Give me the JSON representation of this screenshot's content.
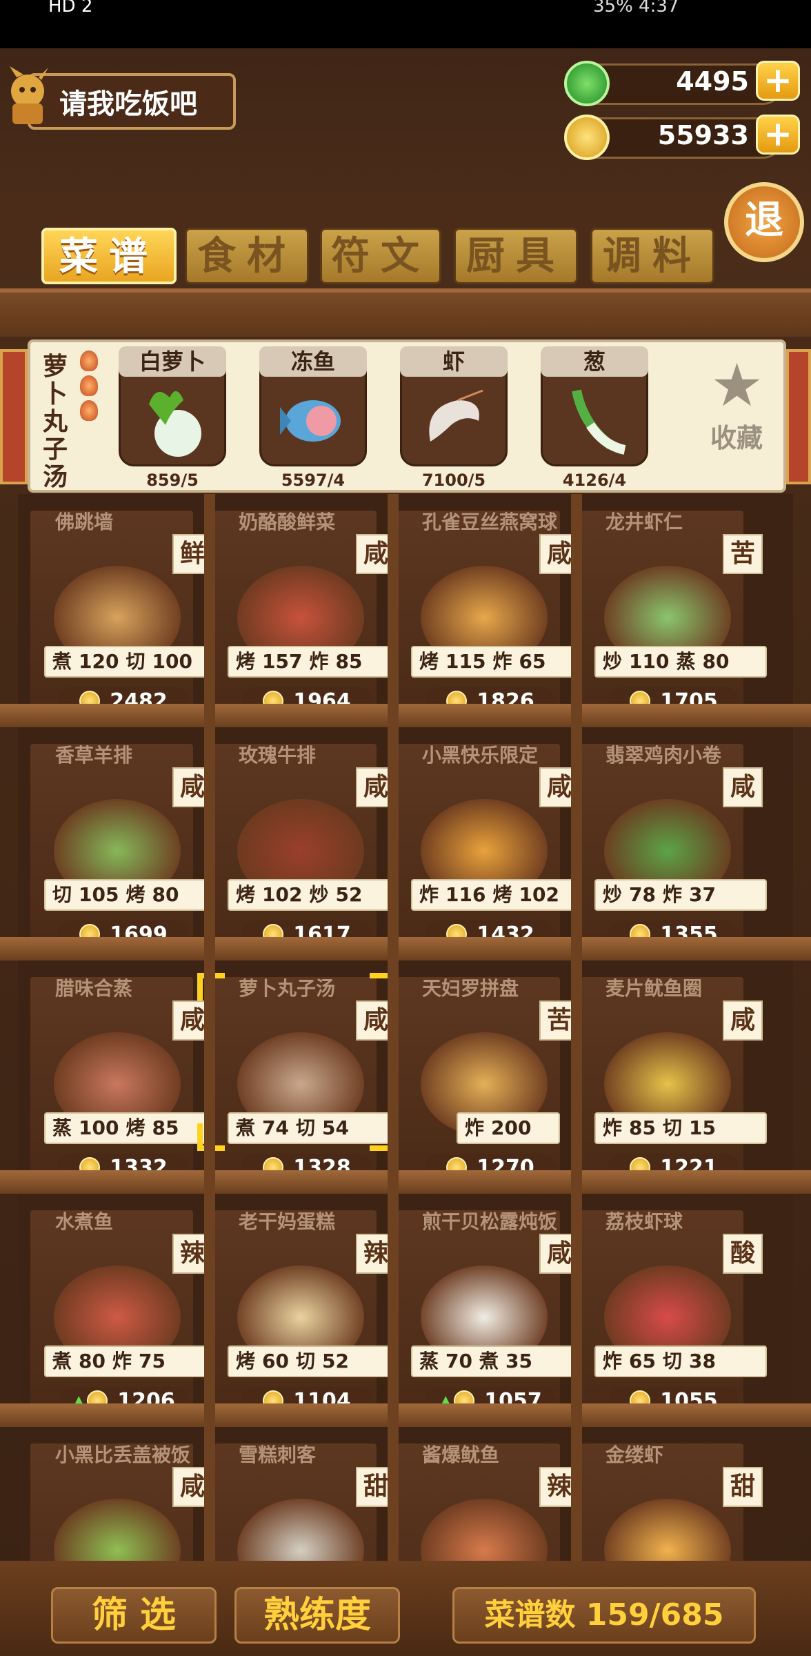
{
  "status_bar": {
    "left": "HD 2",
    "right": "35% 4:37"
  },
  "header": {
    "title": "请我吃饭吧",
    "jade": "4495",
    "coins": "55933",
    "exit_label": "退"
  },
  "tabs": [
    {
      "label": "菜谱",
      "active": true
    },
    {
      "label": "食材",
      "active": false
    },
    {
      "label": "符文",
      "active": false
    },
    {
      "label": "厨具",
      "active": false
    },
    {
      "label": "调料",
      "active": false
    }
  ],
  "selected_recipe": {
    "name": "萝卜丸子汤",
    "ingredients": [
      {
        "name": "白萝卜",
        "count": "859/5"
      },
      {
        "name": "冻鱼",
        "count": "5597/4"
      },
      {
        "name": "虾",
        "count": "7100/5"
      },
      {
        "name": "葱",
        "count": "4126/4"
      }
    ],
    "favorite_label": "收藏"
  },
  "recipes": [
    {
      "title": "佛跳墙",
      "taste": "鲜",
      "stats": [
        [
          "煮",
          "120"
        ],
        [
          "切",
          "100"
        ]
      ],
      "price": "2482",
      "up": false
    },
    {
      "title": "奶酪酸鲜菜",
      "taste": "咸",
      "stats": [
        [
          "烤",
          "157"
        ],
        [
          "炸",
          "85"
        ]
      ],
      "price": "1964",
      "up": false
    },
    {
      "title": "孔雀豆丝燕窝球",
      "taste": "咸",
      "stats": [
        [
          "烤",
          "115"
        ],
        [
          "炸",
          "65"
        ]
      ],
      "price": "1826",
      "up": false
    },
    {
      "title": "龙井虾仁",
      "taste": "苦",
      "stats": [
        [
          "炒",
          "110"
        ],
        [
          "蒸",
          "80"
        ]
      ],
      "price": "1705",
      "up": false
    },
    {
      "title": "香草羊排",
      "taste": "咸",
      "stats": [
        [
          "切",
          "105"
        ],
        [
          "烤",
          "80"
        ]
      ],
      "price": "1699",
      "up": false
    },
    {
      "title": "玫瑰牛排",
      "taste": "咸",
      "stats": [
        [
          "烤",
          "102"
        ],
        [
          "炒",
          "52"
        ]
      ],
      "price": "1617",
      "up": false
    },
    {
      "title": "小黑快乐限定",
      "taste": "咸",
      "stats": [
        [
          "炸",
          "116"
        ],
        [
          "烤",
          "102"
        ]
      ],
      "price": "1432",
      "up": false
    },
    {
      "title": "翡翠鸡肉小卷",
      "taste": "咸",
      "stats": [
        [
          "炒",
          "78"
        ],
        [
          "炸",
          "37"
        ]
      ],
      "price": "1355",
      "up": false
    },
    {
      "title": "腊味合蒸",
      "taste": "咸",
      "stats": [
        [
          "蒸",
          "100"
        ],
        [
          "烤",
          "85"
        ]
      ],
      "price": "1332",
      "up": false
    },
    {
      "title": "萝卜丸子汤",
      "taste": "咸",
      "stats": [
        [
          "煮",
          "74"
        ],
        [
          "切",
          "54"
        ]
      ],
      "price": "1328",
      "up": false,
      "selected": true
    },
    {
      "title": "天妇罗拼盘",
      "taste": "苦",
      "stats": [
        [
          "炸",
          "200"
        ]
      ],
      "price": "1270",
      "up": false
    },
    {
      "title": "麦片鱿鱼圈",
      "taste": "咸",
      "stats": [
        [
          "炸",
          "85"
        ],
        [
          "切",
          "15"
        ]
      ],
      "price": "1221",
      "up": false
    },
    {
      "title": "水煮鱼",
      "taste": "辣",
      "stats": [
        [
          "煮",
          "80"
        ],
        [
          "炸",
          "75"
        ]
      ],
      "price": "1206",
      "up": true
    },
    {
      "title": "老干妈蛋糕",
      "taste": "辣",
      "stats": [
        [
          "烤",
          "60"
        ],
        [
          "切",
          "52"
        ]
      ],
      "price": "1104",
      "up": false
    },
    {
      "title": "煎干贝松露炖饭",
      "taste": "咸",
      "stats": [
        [
          "蒸",
          "70"
        ],
        [
          "煮",
          "35"
        ]
      ],
      "price": "1057",
      "up": true
    },
    {
      "title": "荔枝虾球",
      "taste": "酸",
      "stats": [
        [
          "炸",
          "65"
        ],
        [
          "切",
          "38"
        ]
      ],
      "price": "1055",
      "up": false
    },
    {
      "title": "小黑比丢盖被饭",
      "taste": "咸",
      "stats": [],
      "price": "",
      "up": false
    },
    {
      "title": "雪糕刺客",
      "taste": "甜",
      "stats": [],
      "price": "",
      "up": false
    },
    {
      "title": "酱爆鱿鱼",
      "taste": "辣",
      "stats": [],
      "price": "",
      "up": false
    },
    {
      "title": "金缕虾",
      "taste": "甜",
      "stats": [],
      "price": "",
      "up": false
    }
  ],
  "bottom": {
    "filter": "筛 选",
    "mastery": "熟练度",
    "recipe_count": "菜谱数 159/685"
  }
}
